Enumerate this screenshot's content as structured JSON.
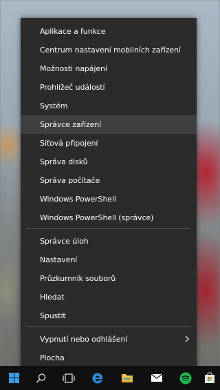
{
  "menu": {
    "items": [
      {
        "label": "Aplikace a funkce"
      },
      {
        "label": "Centrum nastavení mobilních zařízení"
      },
      {
        "label": "Možnosti napájení"
      },
      {
        "label": "Prohlížeč událostí"
      },
      {
        "label": "Systém"
      },
      {
        "label": "Správce zařízení"
      },
      {
        "label": "Síťová připojení"
      },
      {
        "label": "Správa disků"
      },
      {
        "label": "Správa počítače"
      },
      {
        "label": "Windows PowerShell"
      },
      {
        "label": "Windows PowerShell (správce)"
      },
      {
        "label": "Správce úloh"
      },
      {
        "label": "Nastavení"
      },
      {
        "label": "Průzkumník souborů"
      },
      {
        "label": "Hledat"
      },
      {
        "label": "Spustit"
      },
      {
        "label": "Vypnutí nebo odhlášení"
      },
      {
        "label": "Plocha"
      }
    ],
    "highlighted_index": 5
  },
  "taskbar": {
    "icons": [
      "windows-start-icon",
      "search-icon",
      "task-view-icon",
      "edge-icon",
      "file-explorer-icon",
      "mail-icon",
      "spotify-icon",
      "store-icon"
    ]
  },
  "colors": {
    "menu_bg": "#2b2b2b",
    "highlight": "#3f3f3f",
    "taskbar_bg": "#101010",
    "accent_blue": "#2b88d8",
    "spotify_green": "#1db954"
  }
}
